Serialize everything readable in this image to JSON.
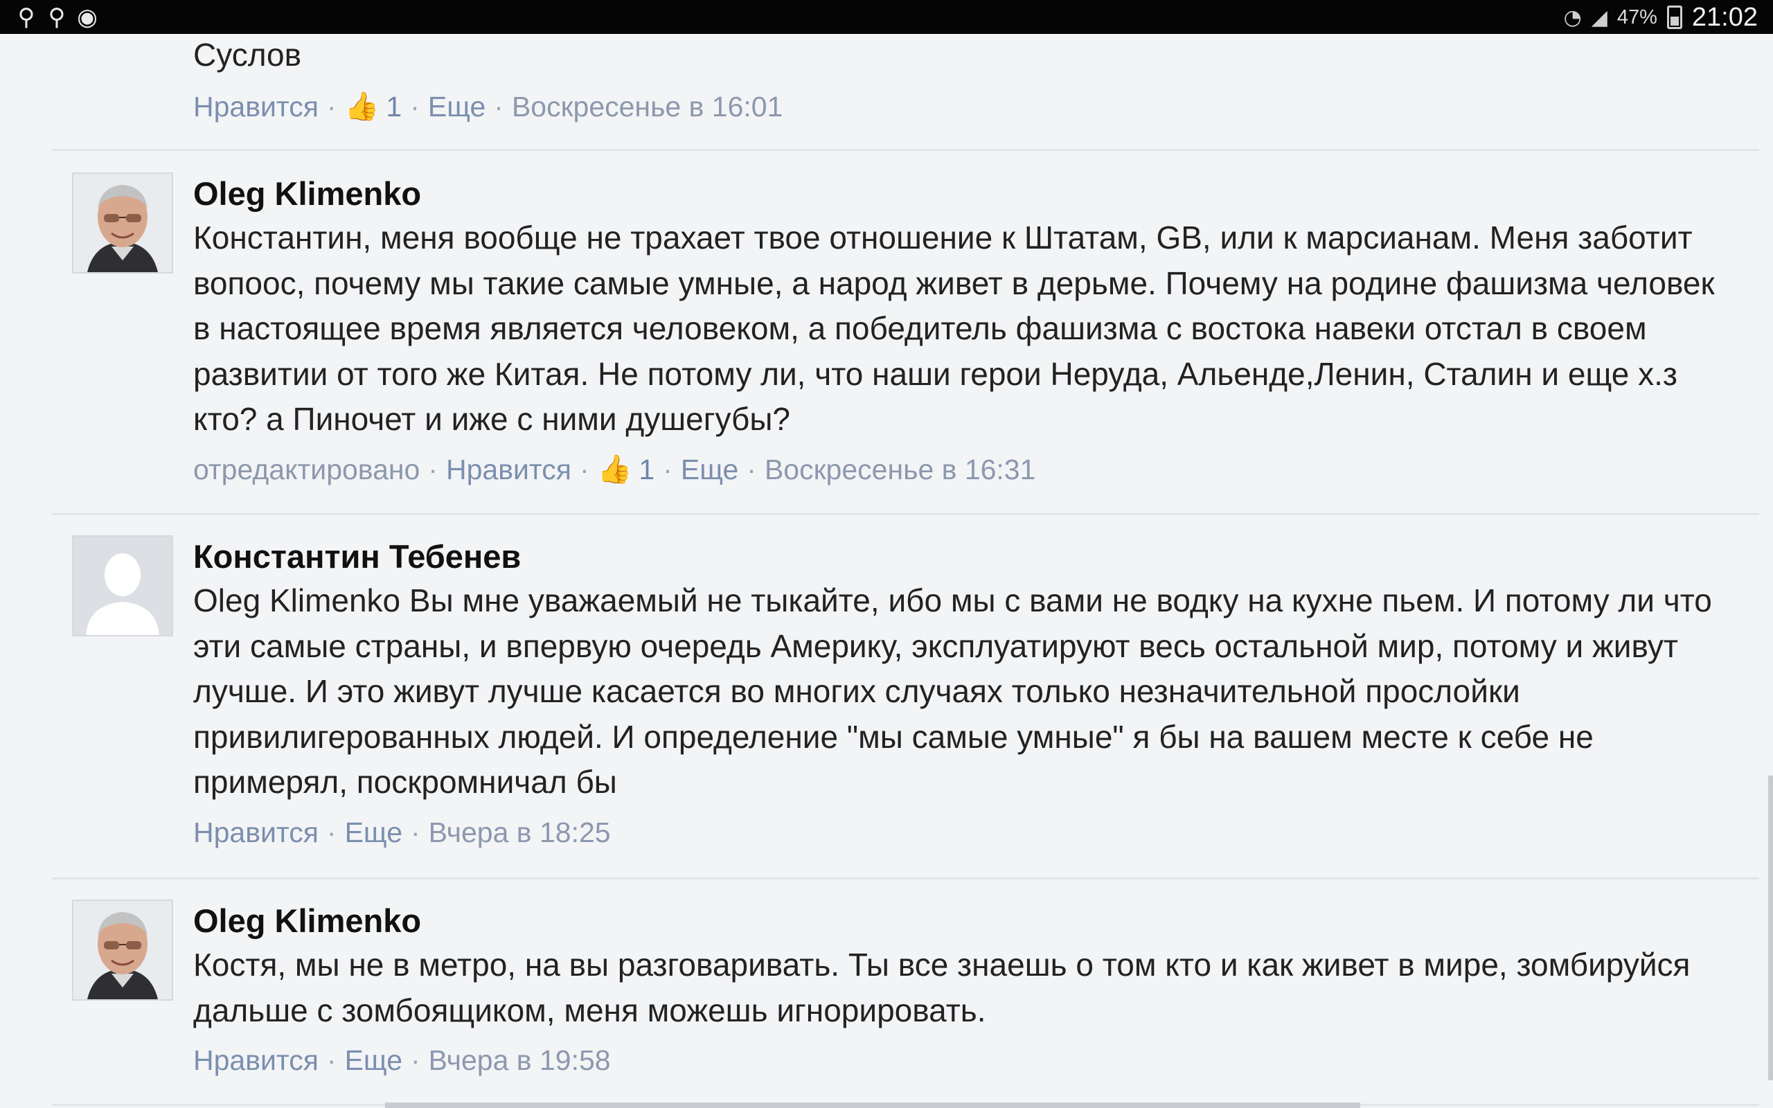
{
  "status_bar": {
    "left_icons": [
      "search-icon",
      "search-icon",
      "app-icon"
    ],
    "wifi_icon": "wifi-icon",
    "signal_icon": "signal-icon",
    "battery_percent": "47%",
    "battery_level": 0.47,
    "time": "21:02"
  },
  "comments": [
    {
      "author": "",
      "text": "Суслов",
      "edited_label": "",
      "like_label": "Нравится",
      "like_count": "1",
      "more_label": "Еще",
      "timestamp": "Воскресенье в 16:01"
    },
    {
      "author": "Oleg Klimenko",
      "avatar": "photo",
      "text": "Константин, меня вообще не трахает твое отношение к Штатам, GB, или к марсианам. Меня заботит вопоос, почему мы такие самые умные, а народ живет в дерьме. Почему на родине фашизма человек в настоящее время является человеком, а победитель фашизма с востока навеки отстал в своем развитии от того же Китая. Не потому ли, что наши герои Неруда, Альенде,Ленин, Сталин и еще х.з кто? а Пиночет и иже с ними душегубы?",
      "edited_label": "отредактировано",
      "like_label": "Нравится",
      "like_count": "1",
      "more_label": "Еще",
      "timestamp": "Воскресенье в 16:31"
    },
    {
      "author": "Константин Тебенев",
      "avatar": "placeholder",
      "text": "Oleg Klimenko Вы мне уважаемый не тыкайте, ибо мы с вами не водку на кухне пьем. И потому ли что эти самые страны, и впервую очередь Америку, эксплуатируют весь остальной мир, потому и живут лучше. И это живут лучше касается во многих случаях только незначительной прослойки привилигерованных людей. И определение \"мы самые умные\" я бы на вашем месте к себе не примерял, поскромничал бы",
      "edited_label": "",
      "like_label": "Нравится",
      "like_count": "",
      "more_label": "Еще",
      "timestamp": "Вчера в 18:25"
    },
    {
      "author": "Oleg Klimenko",
      "avatar": "photo",
      "text": "Костя, мы не в метро, на вы разговаривать. Ты все знаешь о том кто и как живет в мире, зомбируйся дальше с зомбоящиком, меня можешь игнорировать.",
      "edited_label": "",
      "like_label": "Нравится",
      "like_count": "",
      "more_label": "Еще",
      "timestamp": "Вчера в 19:58"
    }
  ],
  "icons": {
    "thumb": "thumbs-up-icon"
  }
}
